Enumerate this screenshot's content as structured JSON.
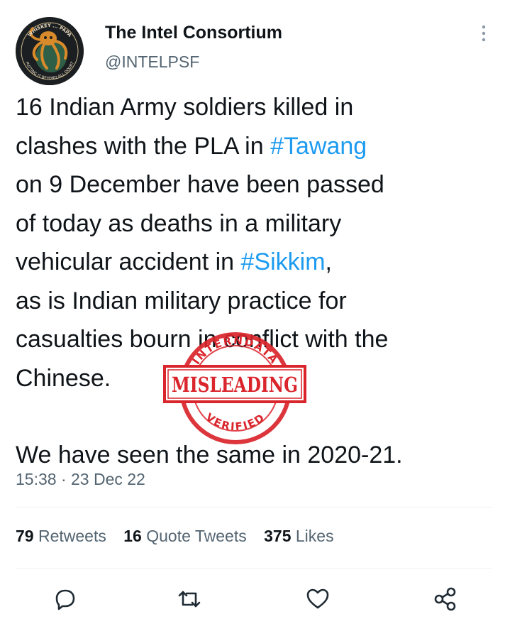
{
  "tweet": {
    "author_name": "The Intel Consortium",
    "author_handle": "@INTELPSF",
    "body_lines": [
      [
        {
          "text": "16 Indian Army soldiers killed in"
        }
      ],
      [
        {
          "text": "clashes with the PLA in "
        },
        {
          "text": "#Tawang",
          "hashtag": true
        }
      ],
      [
        {
          "text": "on 9 December have been passed"
        }
      ],
      [
        {
          "text": "of today as deaths in a military"
        }
      ],
      [
        {
          "text": "vehicular accident in "
        },
        {
          "text": "#Sikkim",
          "hashtag": true
        },
        {
          "text": ","
        }
      ],
      [
        {
          "text": "as is Indian military practice for"
        }
      ],
      [
        {
          "text": "casualties bourn in conflict with the"
        }
      ],
      [
        {
          "text": "Chinese."
        }
      ],
      [],
      [
        {
          "text": "We have seen the same in 2020-21."
        }
      ]
    ],
    "timestamp": "15:38 · 23 Dec 22",
    "stats": {
      "retweets_count": "79",
      "retweets_label": "Retweets",
      "quotes_count": "16",
      "quotes_label": "Quote Tweets",
      "likes_count": "375",
      "likes_label": "Likes"
    }
  },
  "avatar": {
    "ring_text_top": "WHISKEY ... PAPA",
    "ring_text_bottom": "PUTTING IT BEYOND ALL DOUBT"
  },
  "stamp": {
    "label": "MISLEADING",
    "top_text": "INTERNDATA",
    "bottom_text": "VERIFIED",
    "color": "#d9252b"
  },
  "colors": {
    "hashtag": "#1d9bf0",
    "secondary": "#536471",
    "text": "#0f1419",
    "stamp": "#d9252b"
  },
  "icons": [
    "more-icon",
    "reply-icon",
    "retweet-icon",
    "like-icon",
    "share-icon"
  ]
}
